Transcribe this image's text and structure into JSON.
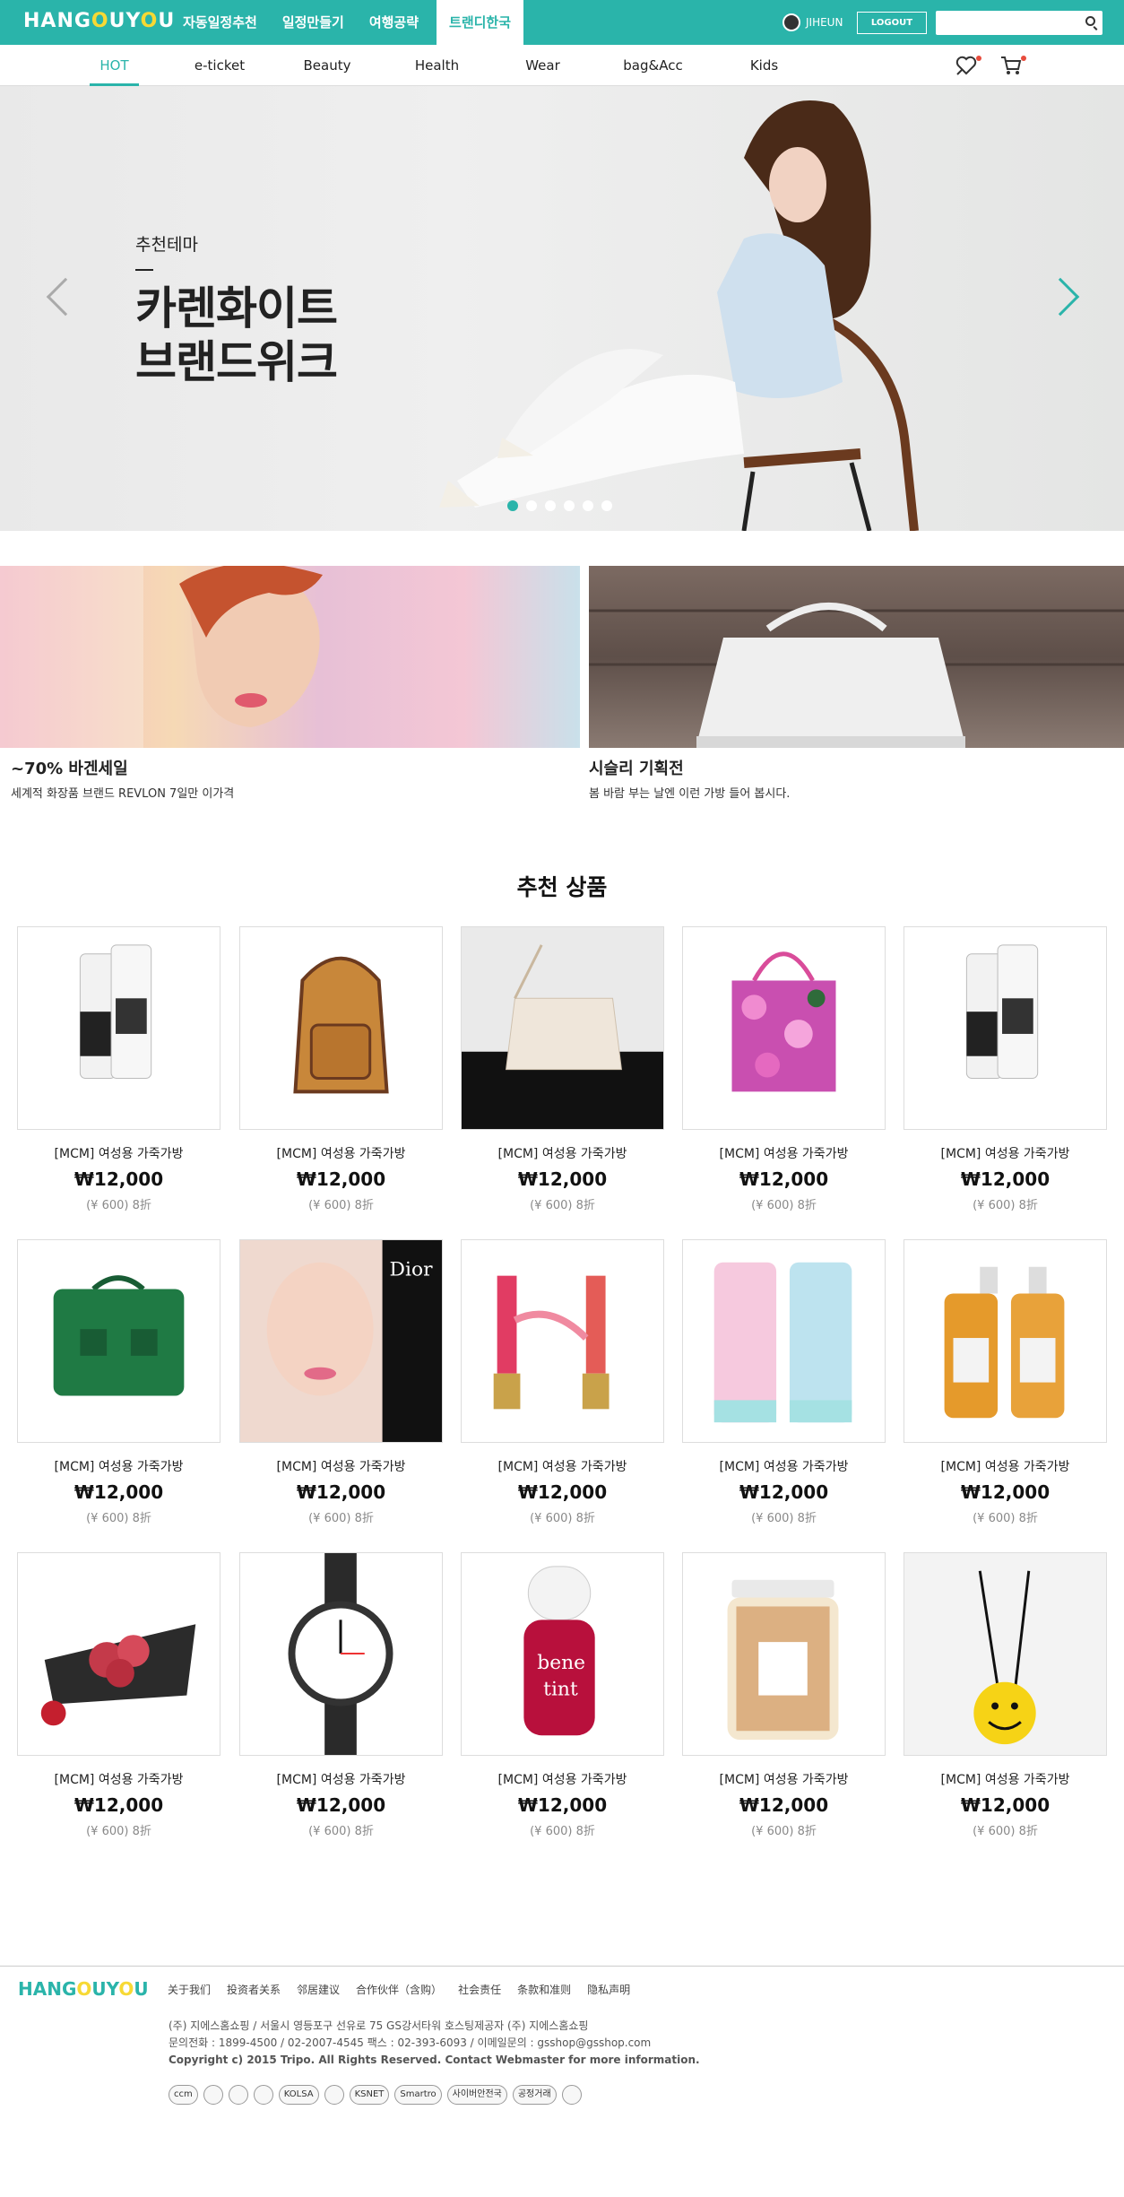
{
  "brand": {
    "logo_pre": "HANG",
    "logo_o": "O",
    "logo_mid": "UY",
    "logo_o2": "O",
    "logo_post": "U"
  },
  "topnav": [
    {
      "label": "자동일정추천"
    },
    {
      "label": "일정만들기"
    },
    {
      "label": "여행공략"
    },
    {
      "label": "트랜디한국",
      "active": true
    }
  ],
  "user": {
    "name": "JIHEUN",
    "logout_label": "LOGOUT"
  },
  "search": {
    "placeholder": ""
  },
  "categories": [
    {
      "label": "HOT",
      "active": true
    },
    {
      "label": "e-ticket"
    },
    {
      "label": "Beauty"
    },
    {
      "label": "Health"
    },
    {
      "label": "Wear"
    },
    {
      "label": "bag&Acc"
    },
    {
      "label": "Kids"
    }
  ],
  "hero": {
    "subtitle": "추천테마",
    "title_line1": "카렌화이트",
    "title_line2": "브랜드위크",
    "slide_count": 6,
    "active_slide": 1
  },
  "banners": [
    {
      "title": "~70% 바겐세일",
      "desc": "세계적 화장품 브랜드 REVLON 7일만 이가격"
    },
    {
      "title": "시슬리 기획전",
      "desc": "봄 바람 부는 날엔 이런 가방 들어 봅시다."
    }
  ],
  "section_title": "추천 상품",
  "products": [
    {
      "name": "[MCM] 여성용 가죽가방",
      "price": "₩12,000",
      "cny": "(¥ 600) 8折",
      "icon": "cosmetic-tubes"
    },
    {
      "name": "[MCM] 여성용 가죽가방",
      "price": "₩12,000",
      "cny": "(¥ 600) 8折",
      "icon": "backpack"
    },
    {
      "name": "[MCM] 여성용 가죽가방",
      "price": "₩12,000",
      "cny": "(¥ 600) 8折",
      "icon": "quilted-bag"
    },
    {
      "name": "[MCM] 여성용 가죽가방",
      "price": "₩12,000",
      "cny": "(¥ 600) 8折",
      "icon": "floral-tote"
    },
    {
      "name": "[MCM] 여성용 가죽가방",
      "price": "₩12,000",
      "cny": "(¥ 600) 8折",
      "icon": "cosmetic-tubes"
    },
    {
      "name": "[MCM] 여성용 가죽가방",
      "price": "₩12,000",
      "cny": "(¥ 600) 8折",
      "icon": "green-satchel"
    },
    {
      "name": "[MCM] 여성용 가죽가방",
      "price": "₩12,000",
      "cny": "(¥ 600) 8折",
      "icon": "dior-ad"
    },
    {
      "name": "[MCM] 여성용 가죽가방",
      "price": "₩12,000",
      "cny": "(¥ 600) 8折",
      "icon": "lip-gloss"
    },
    {
      "name": "[MCM] 여성용 가죽가방",
      "price": "₩12,000",
      "cny": "(¥ 600) 8折",
      "icon": "floral-tubes"
    },
    {
      "name": "[MCM] 여성용 가죽가방",
      "price": "₩12,000",
      "cny": "(¥ 600) 8折",
      "icon": "juice-bottles"
    },
    {
      "name": "[MCM] 여성용 가죽가방",
      "price": "₩12,000",
      "cny": "(¥ 600) 8折",
      "icon": "flower-bouquet"
    },
    {
      "name": "[MCM] 여성용 가죽가방",
      "price": "₩12,000",
      "cny": "(¥ 600) 8折",
      "icon": "wrist-watch"
    },
    {
      "name": "[MCM] 여성용 가죽가방",
      "price": "₩12,000",
      "cny": "(¥ 600) 8折",
      "icon": "bene-tint"
    },
    {
      "name": "[MCM] 여성용 가죽가방",
      "price": "₩12,000",
      "cny": "(¥ 600) 8折",
      "icon": "snack-jar"
    },
    {
      "name": "[MCM] 여성용 가죽가방",
      "price": "₩12,000",
      "cny": "(¥ 600) 8折",
      "icon": "smiley-bag"
    }
  ],
  "footer": {
    "links": [
      "关于我们",
      "投资者关系",
      "邻居建议",
      "合作伙伴（含购）",
      "社会责任",
      "条款和准则",
      "隐私声明"
    ],
    "address_line1": "(주) 지에스홈쇼핑  / 서울시 영등포구 선유로 75 GS강서타워 호스팅제공자 (주) 지에스홈쇼핑",
    "address_line2": "문의전화 : 1899-4500 / 02-2007-4545 팩스 : 02-393-6093 / 이메일문의 : gsshop@gsshop.com",
    "copyright": "Copyright c) 2015 Tripo. All Rights Reserved. Contact Webmaster for more information.",
    "badges": [
      "ccm",
      "",
      "",
      "",
      "KOLSA",
      "",
      "KSNET",
      "Smartro",
      "사이버안전국",
      "공정거래",
      ""
    ]
  },
  "colors": {
    "accent": "#2ab4aa",
    "logo_o": "#f7d934",
    "alert_dot": "#e84c3d"
  }
}
